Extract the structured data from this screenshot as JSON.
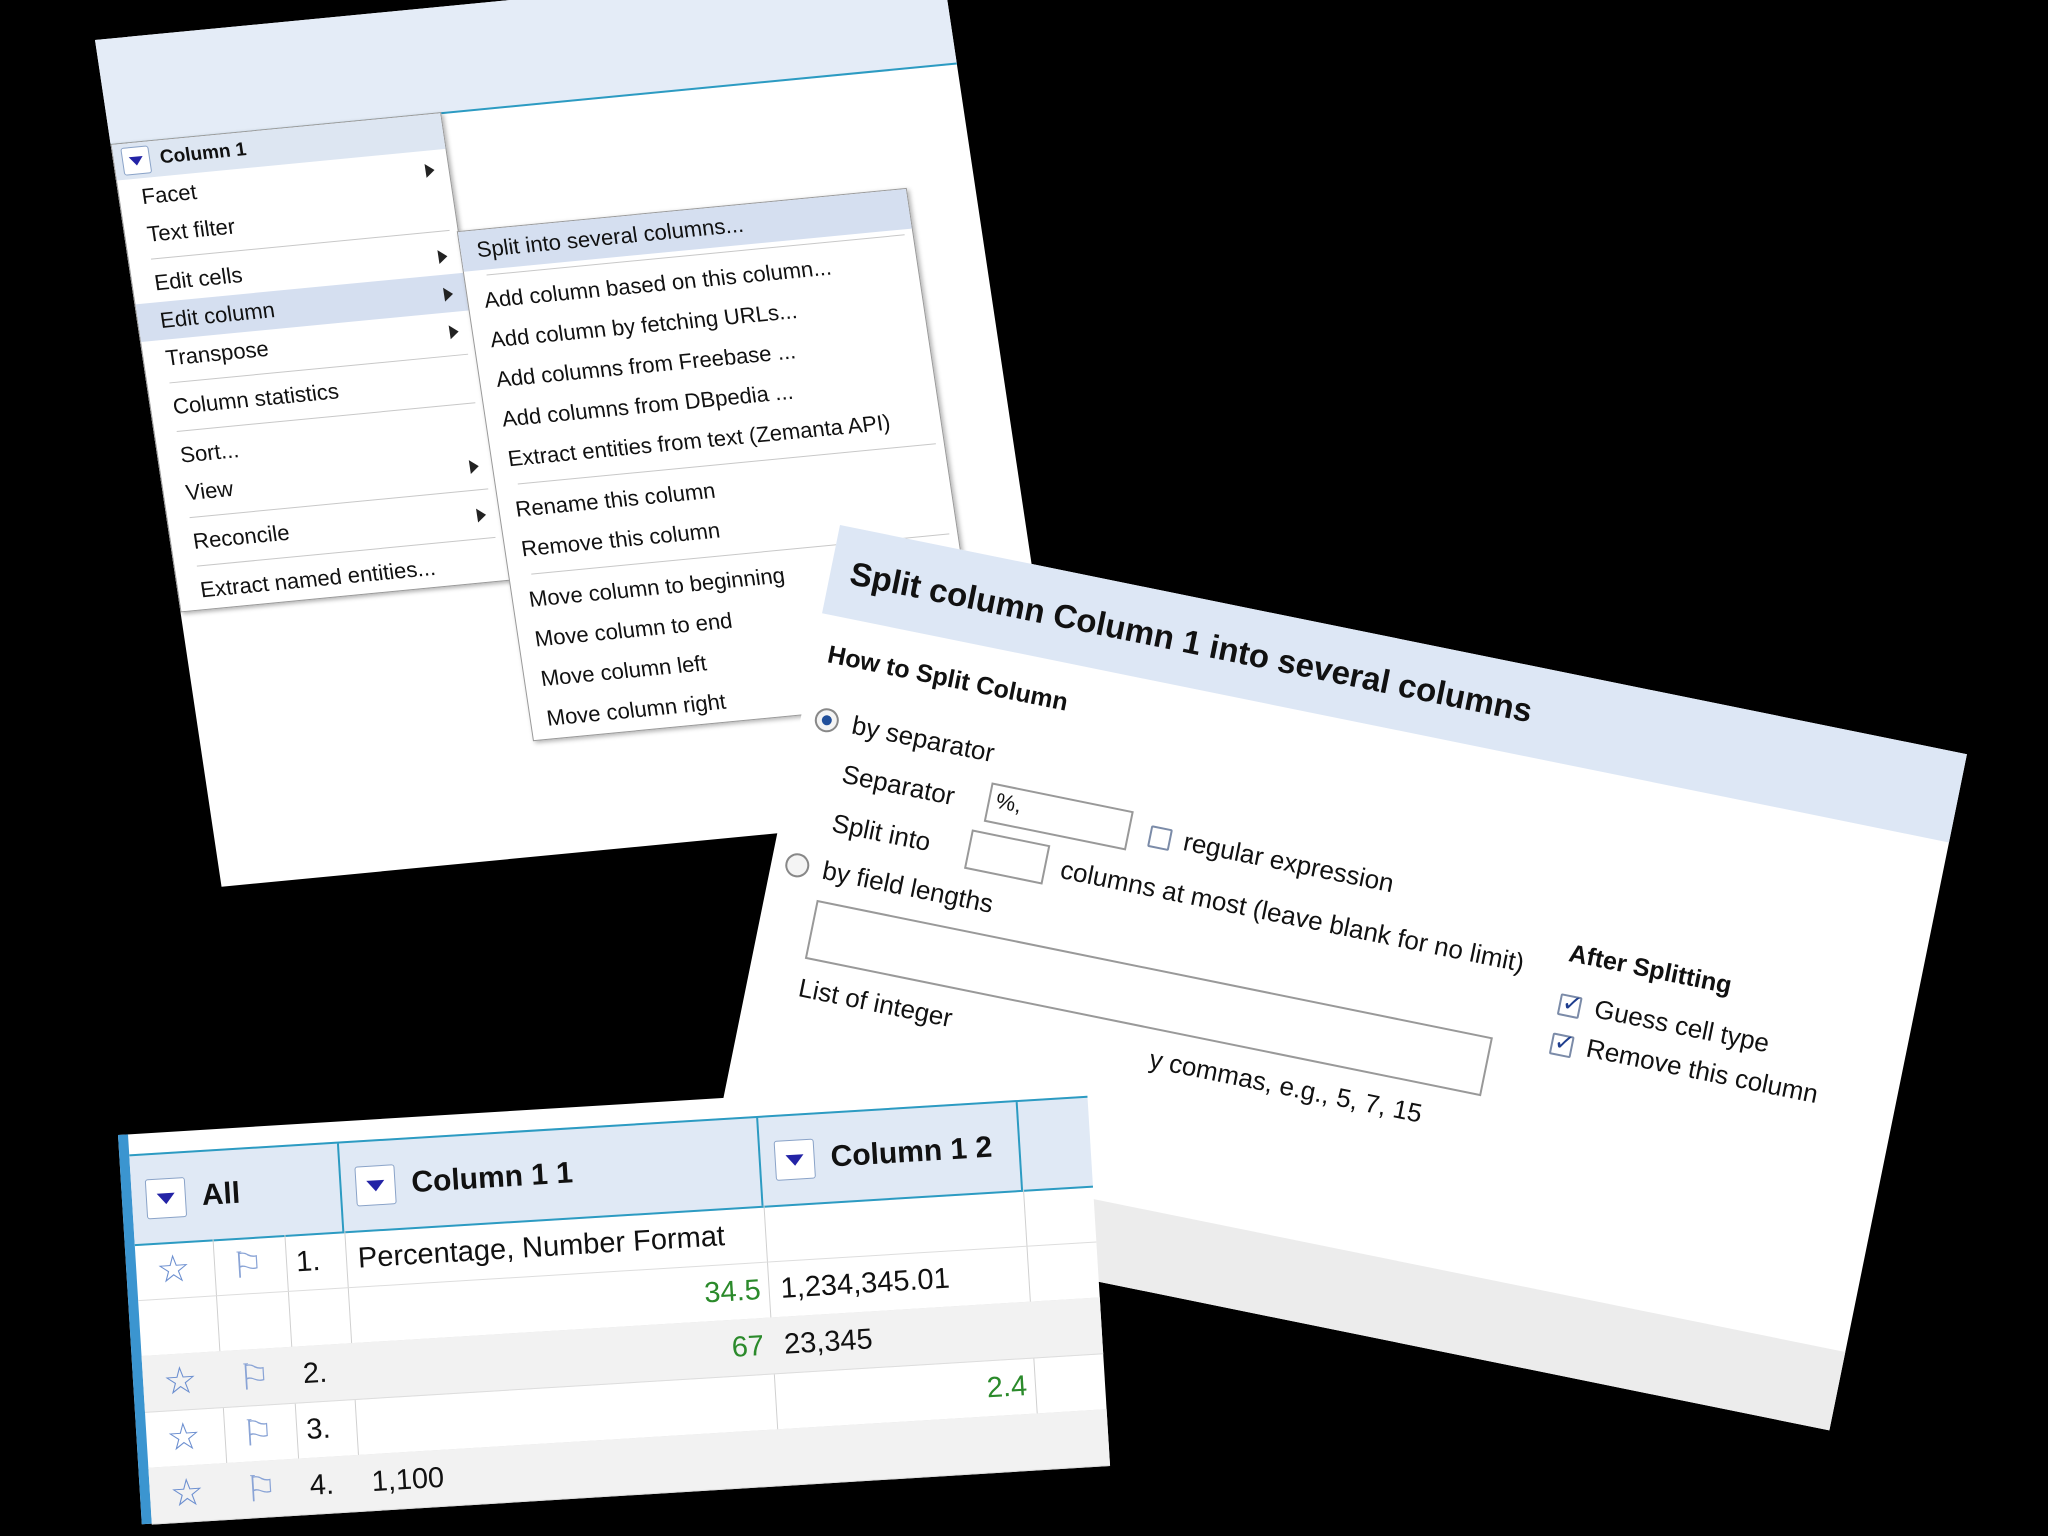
{
  "menu": {
    "column_name": "Column 1",
    "items": [
      {
        "label": "Facet",
        "submenu": true
      },
      {
        "label": "Text filter",
        "submenu": false
      },
      {
        "label": "Edit cells",
        "submenu": true
      },
      {
        "label": "Edit column",
        "submenu": true
      },
      {
        "label": "Transpose",
        "submenu": true
      },
      {
        "label": "Column statistics",
        "submenu": false
      },
      {
        "label": "Sort...",
        "submenu": false
      },
      {
        "label": "View",
        "submenu": true
      },
      {
        "label": "Reconcile",
        "submenu": true
      },
      {
        "label": "Extract named entities...",
        "submenu": false
      }
    ],
    "submenu_items": [
      "Split into several columns...",
      "Add column based on this column...",
      "Add column by fetching URLs...",
      "Add columns from Freebase ...",
      "Add columns from DBpedia ...",
      "Extract entities from text (Zemanta API)",
      "Rename this column",
      "Remove this column",
      "Move column to beginning",
      "Move column to end",
      "Move column left",
      "Move column right"
    ]
  },
  "dialog": {
    "title": "Split column Column 1 into several columns",
    "how_heading": "How to Split Column",
    "by_separator": "by separator",
    "separator_label": "Separator",
    "separator_value": "%,",
    "regex_label": "regular expression",
    "split_into_label": "Split into",
    "split_into_value": "",
    "columns_at_most": "columns at most (leave blank for no limit)",
    "by_field_lengths": "by field lengths",
    "field_lengths_value": "",
    "list_of_integers_prefix": "List of integer",
    "list_of_integers_suffix": "y commas, e.g., 5, 7, 15",
    "after_heading": "After Splitting",
    "guess_cell_type": "Guess cell type",
    "remove_column": "Remove this column"
  },
  "table": {
    "all_label": "All",
    "col1": "Column 1 1",
    "col2": "Column 1 2",
    "rows": [
      {
        "num": "1.",
        "c1_text": "Percentage, Number Format",
        "c1_num": "",
        "c2_text": "",
        "c2_num": ""
      },
      {
        "num": "",
        "c1_text": "",
        "c1_num": "34.5",
        "c2_text": "1,234,345.01",
        "c2_num": ""
      },
      {
        "num": "2.",
        "c1_text": "",
        "c1_num": "67",
        "c2_text": "23,345",
        "c2_num": ""
      },
      {
        "num": "3.",
        "c1_text": "",
        "c1_num": "",
        "c2_text": "",
        "c2_num": "2.4"
      },
      {
        "num": "4.",
        "c1_text": "1,100",
        "c1_num": "",
        "c2_text": "",
        "c2_num": ""
      }
    ]
  },
  "colors": {
    "accent": "#2c9bc2",
    "menu_highlight": "#d5dff0",
    "numeric_text": "#2b8a2b"
  }
}
